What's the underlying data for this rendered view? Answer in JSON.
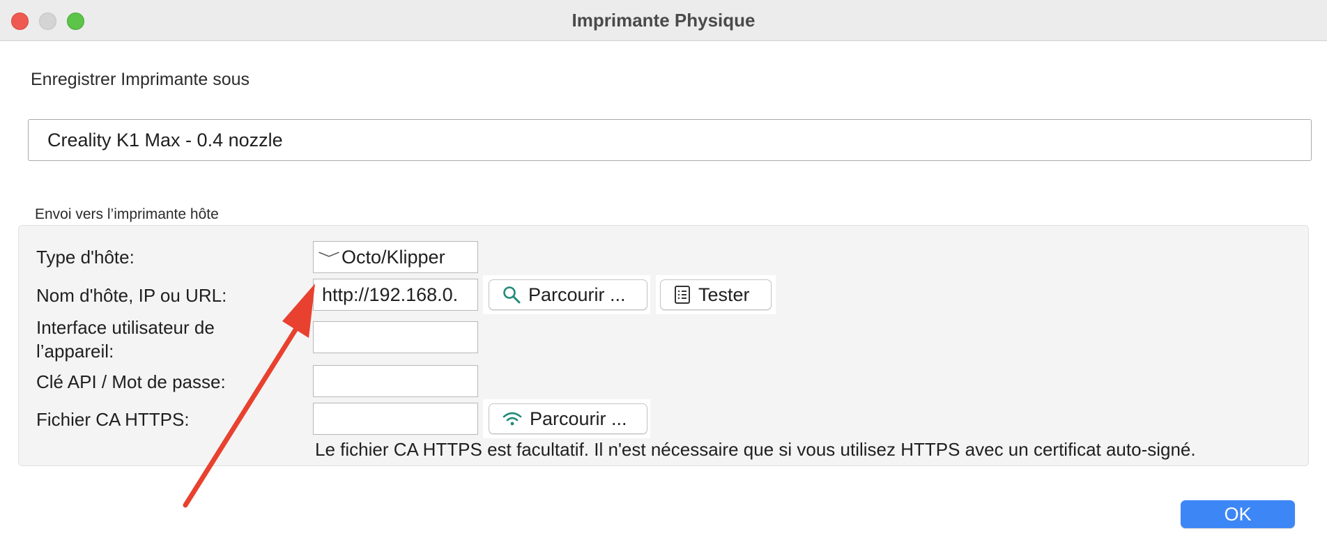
{
  "window": {
    "title": "Imprimante Physique"
  },
  "save_section": {
    "label": "Enregistrer Imprimante sous",
    "printer_name_value": "Creality K1 Max - 0.4 nozzle"
  },
  "host_section": {
    "title": "Envoi vers l’imprimante hôte",
    "host_type": {
      "label": "Type d'hôte:",
      "selected": "Octo/Klipper"
    },
    "hostname": {
      "label": "Nom d'hôte, IP ou URL:",
      "value": "http://192.168.0.",
      "browse_label": "Parcourir ...",
      "test_label": "Tester"
    },
    "device_ui": {
      "label_line1": "Interface utilisateur de",
      "label_line2": "l’appareil:",
      "value": ""
    },
    "api_key": {
      "label": "Clé API / Mot de passe:",
      "value": ""
    },
    "https_ca": {
      "label": "Fichier CA HTTPS:",
      "value": "",
      "browse_label": "Parcourir ..."
    },
    "hint": "Le fichier CA HTTPS est facultatif. Il n'est nécessaire que si vous utilisez HTTPS avec un certificat auto-signé."
  },
  "footer": {
    "ok_label": "OK"
  },
  "colors": {
    "accent_button": "#3d86f5",
    "annotation_arrow": "#e8412f",
    "icon_teal": "#1f8a7a"
  },
  "icons": {
    "search": "search-icon",
    "test": "document-list-icon",
    "wifi": "wifi-icon",
    "dropdown": "chevron-down-icon"
  }
}
